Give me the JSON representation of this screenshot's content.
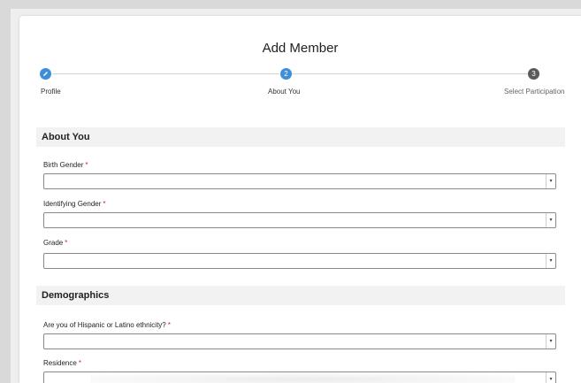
{
  "header": {
    "title": "Add Member"
  },
  "stepper": {
    "steps": [
      {
        "label": "Profile",
        "marker": "",
        "state": "complete"
      },
      {
        "label": "About You",
        "marker": "2",
        "state": "active"
      },
      {
        "label": "Select Participation",
        "marker": "3",
        "state": "upcoming"
      }
    ],
    "colors": {
      "active": "#3d8fd9",
      "upcoming": "#5a5a5a"
    }
  },
  "sections": {
    "about_you": {
      "title": "About You",
      "fields": [
        {
          "label": "Birth Gender",
          "required": "*",
          "value": ""
        },
        {
          "label": "Identifying Gender",
          "required": "*",
          "value": ""
        },
        {
          "label": "Grade",
          "required": "*",
          "value": ""
        }
      ]
    },
    "demographics": {
      "title": "Demographics",
      "fields": [
        {
          "label": "Are you of Hispanic or Latino ethnicity?",
          "required": "*",
          "value": ""
        },
        {
          "label": "Residence",
          "required": "*",
          "value": ""
        }
      ]
    }
  },
  "icons": {
    "edit": "pencil-icon",
    "dropdown": "chevron-down-icon"
  },
  "dropdown_glyph": "▾"
}
